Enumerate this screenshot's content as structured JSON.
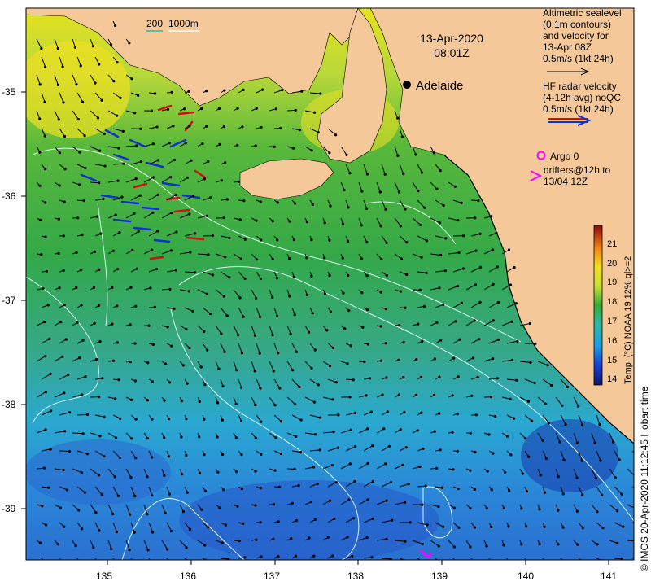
{
  "map": {
    "date_line1": "13-Apr-2020",
    "date_line2": "08:01Z",
    "city": "Adelaide",
    "scale_label_200": "200",
    "scale_label_1000": "1000m",
    "lon_ticks": [
      "135",
      "136",
      "137",
      "138",
      "139",
      "140",
      "141"
    ],
    "lat_ticks": [
      "-35",
      "-36",
      "-37",
      "-38",
      "-39"
    ],
    "legend": {
      "altimetric_lines": [
        "Altimetric sealevel",
        "(0.1m contours)",
        "and velocity for",
        "13-Apr 08Z",
        "0.5m/s (1kt 24h)"
      ],
      "hf_lines": [
        "HF radar velocity",
        "(4-12h avg) noQC",
        "0.5m/s (1kt 24h)"
      ],
      "argo_label": "Argo 0",
      "drifter_lines": [
        "drifters@12h to",
        "13/04 12Z"
      ]
    },
    "colorbar": {
      "ticks": [
        "14",
        "15",
        "16",
        "17",
        "18",
        "19",
        "20",
        "21"
      ],
      "label": "Temp. (°C) NOAA 19 12% ql>=2"
    },
    "side_credit": "© IMOS 20-Apr-2020 11:12:45 Hobart time",
    "colors": {
      "land": "#f5c89a",
      "sea_warm": "#f0e020",
      "sea_mid": "#2fa83a",
      "sea_cool": "#29a8d8",
      "sea_cold": "#1a3fb0",
      "hf_blue": "#1030d0",
      "hf_red": "#d01010",
      "drifter": "#ff00ff",
      "contour": "#e8ffff"
    }
  }
}
